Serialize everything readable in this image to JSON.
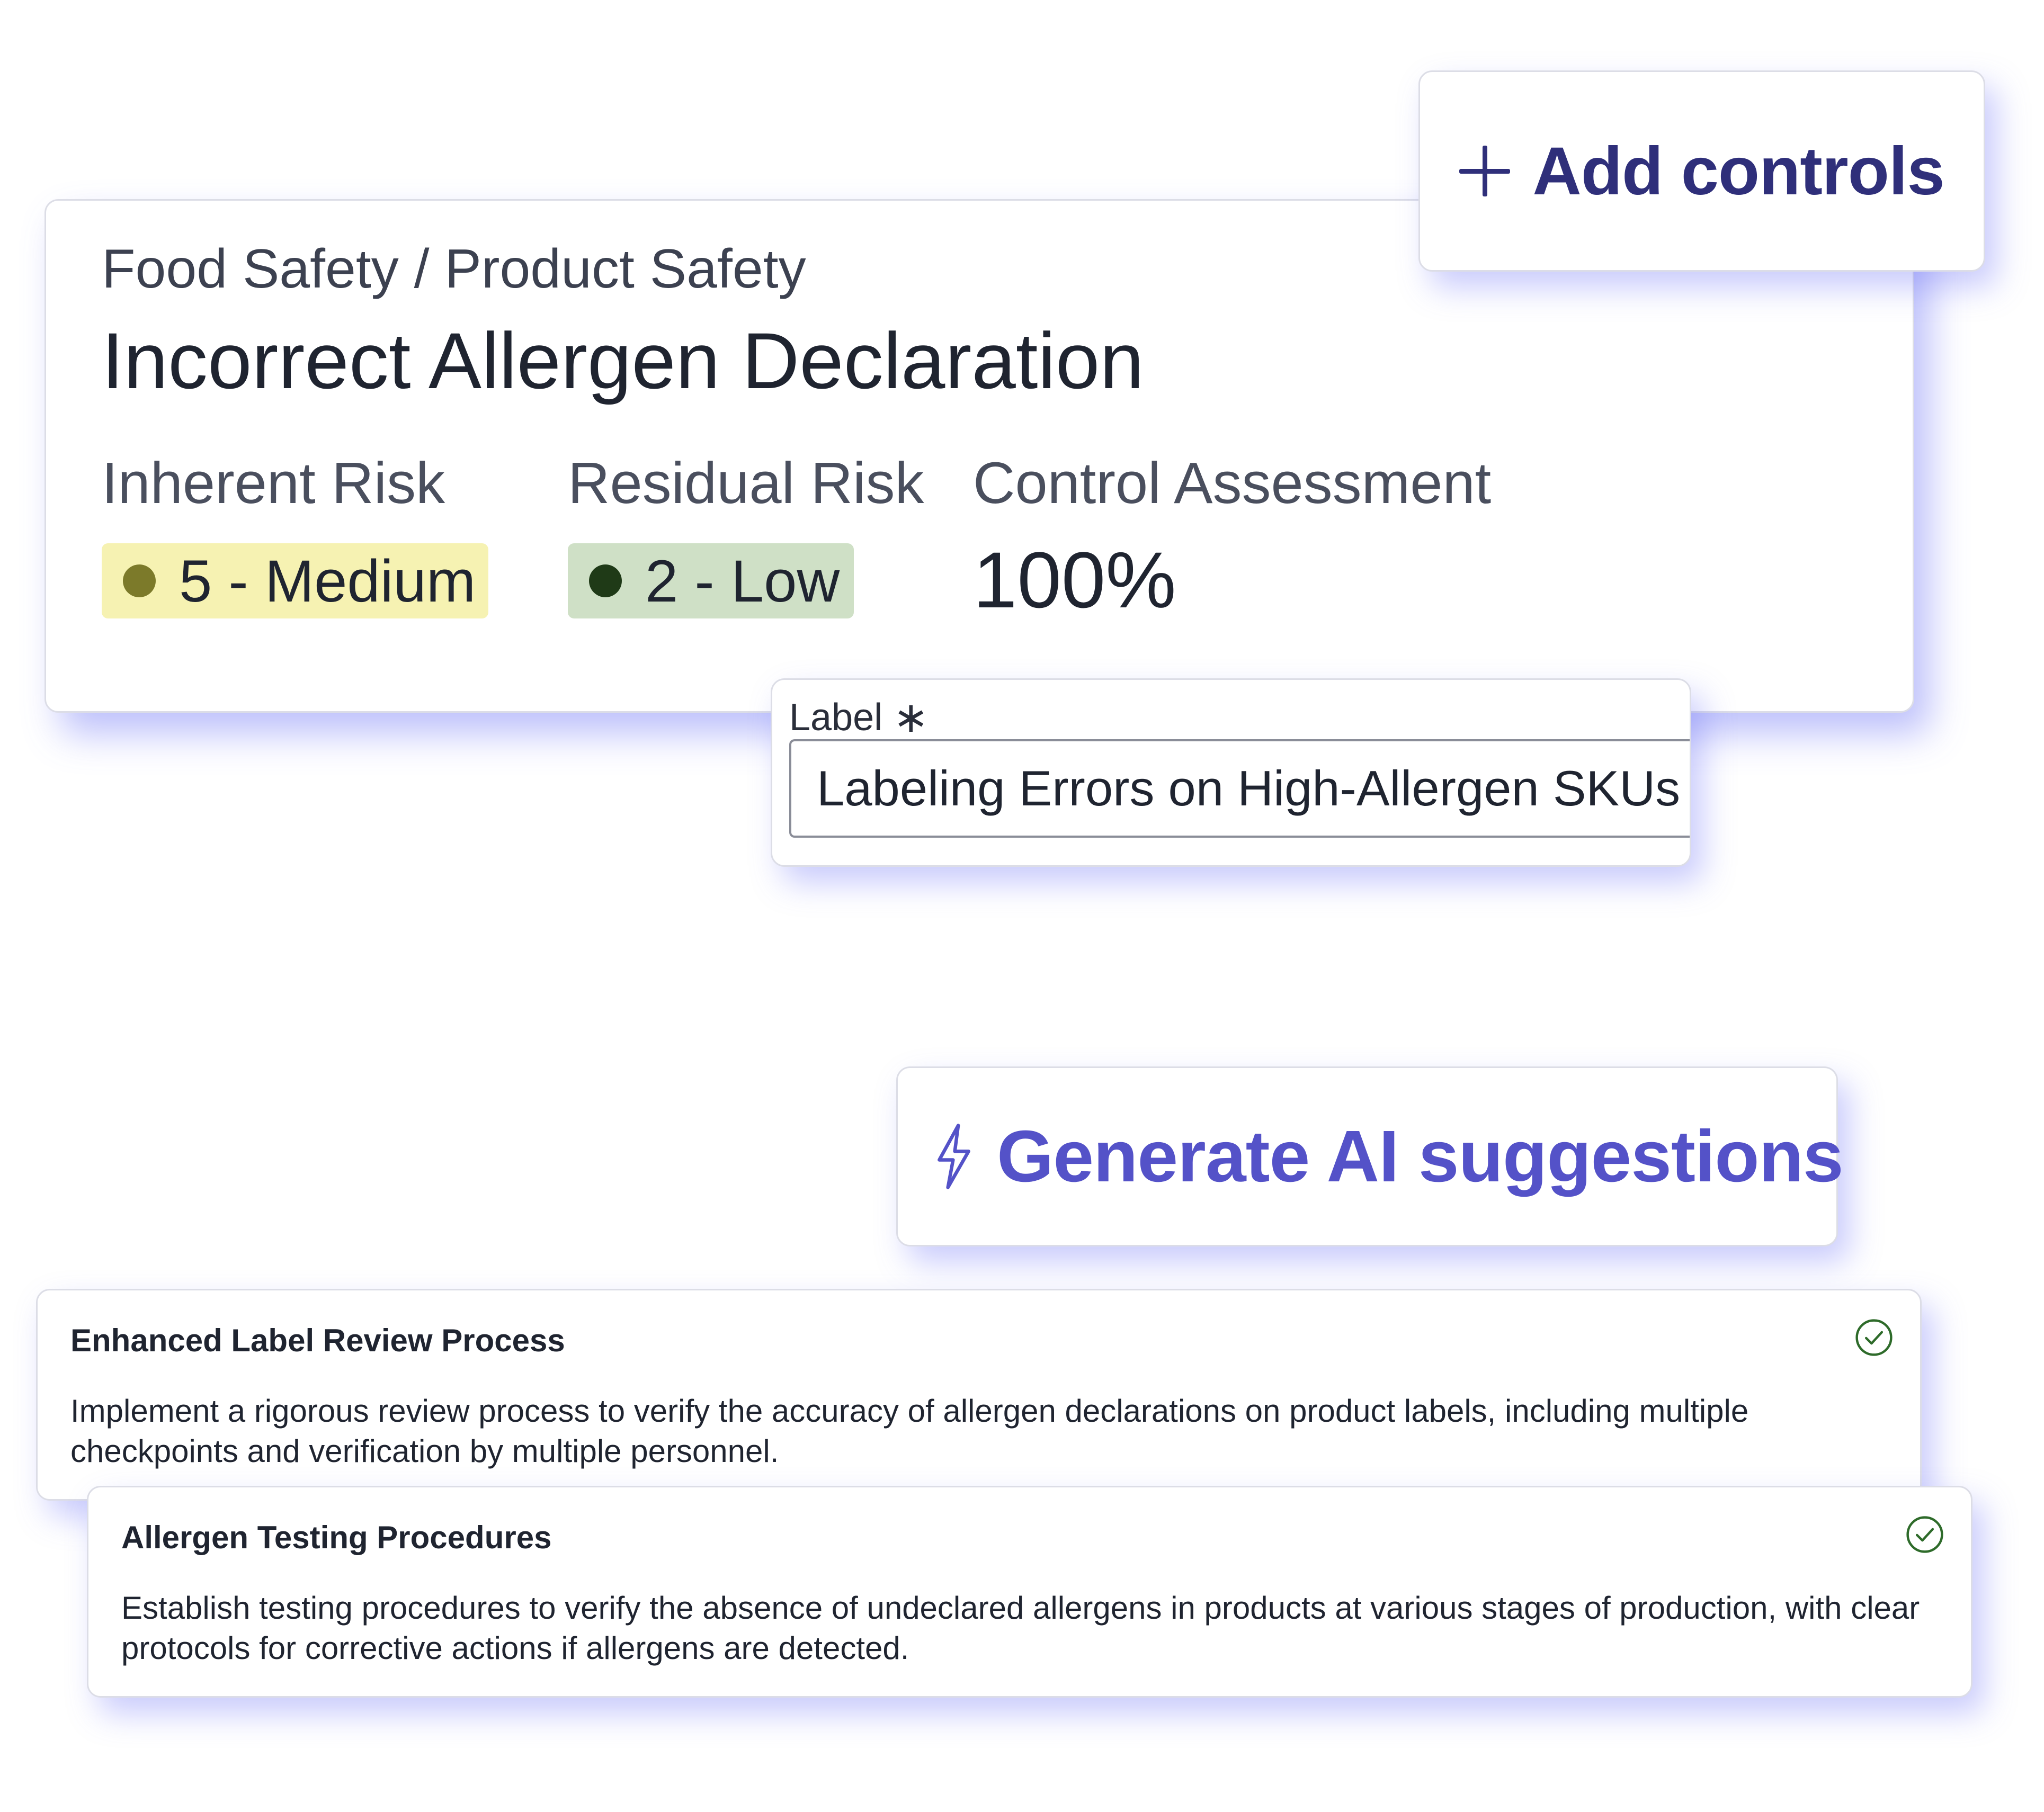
{
  "risk": {
    "breadcrumb": "Food Safety / Product Safety",
    "title": "Incorrect Allergen Declaration",
    "inherent_label": "Inherent Risk",
    "inherent_value": "5 - Medium",
    "residual_label": "Residual Risk",
    "residual_value": "2 - Low",
    "assessment_label": "Control Assessment",
    "assessment_value": "100%"
  },
  "buttons": {
    "add_controls": "Add controls",
    "generate_ai": "Generate AI suggestions"
  },
  "label_field": {
    "label": "Label",
    "required_marker": "∗",
    "value": "Labeling Errors on High-Allergen SKUs"
  },
  "suggestions": [
    {
      "title": "Enhanced Label Review Process",
      "description": "Implement a rigorous review process to verify the accuracy of allergen declarations on product labels, including multiple checkpoints and verification by multiple personnel."
    },
    {
      "title": "Allergen Testing Procedures",
      "description": "Establish testing procedures to verify the absence of undeclared allergens in products at various stages of production, with clear protocols for corrective actions if allergens are detected."
    }
  ],
  "colors": {
    "accent": "#5452c8",
    "button_text_dark": "#2f2f7a",
    "medium_badge_bg": "#f6f2b2",
    "medium_dot": "#7c7a2a",
    "low_badge_bg": "#cfe0c6",
    "low_dot": "#1f3a17",
    "check": "#2e6b2a",
    "glow": "#6268f5"
  },
  "icons": {
    "add": "plus-icon",
    "ai": "lightning-bolt-icon",
    "accepted": "check-circle-icon"
  }
}
